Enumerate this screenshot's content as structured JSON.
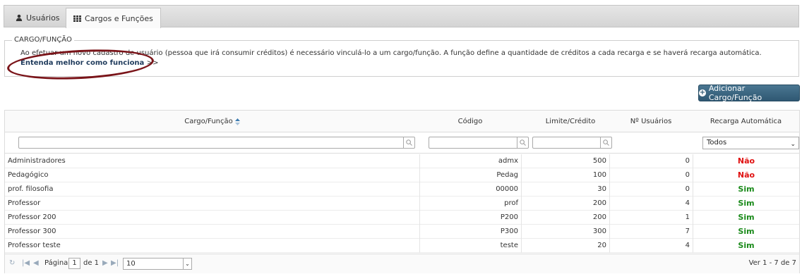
{
  "tabs": [
    {
      "label": "Usuários",
      "icon": "user-icon"
    },
    {
      "label": "Cargos e Funções",
      "icon": "grid-icon"
    }
  ],
  "section": {
    "legend": "CARGO/FUNÇÃO",
    "text": "Ao efetuar um novo cadastro de usuário (pessoa que irá consumir créditos) é necessário vinculá-lo a um cargo/função. A função define a quantidade de créditos a cada recarga e se haverá recarga automática.",
    "link": "Entenda melhor como funciona",
    "link_suffix": ">>"
  },
  "add_button": "Adicionar Cargo/Função",
  "grid": {
    "columns": {
      "name": "Cargo/Função",
      "code": "Código",
      "limit": "Limite/Crédito",
      "users": "Nº Usuários",
      "recharge": "Recarga Automática"
    },
    "filter_select": "Todos",
    "rows": [
      {
        "name": "Administradores",
        "code": "admx",
        "limit": "500",
        "users": "0",
        "recharge": "Não"
      },
      {
        "name": "Pedagógico",
        "code": "Pedag",
        "limit": "100",
        "users": "0",
        "recharge": "Não"
      },
      {
        "name": "prof. filosofia",
        "code": "00000",
        "limit": "30",
        "users": "0",
        "recharge": "Sim"
      },
      {
        "name": "Professor",
        "code": "prof",
        "limit": "200",
        "users": "4",
        "recharge": "Sim"
      },
      {
        "name": "Professor 200",
        "code": "P200",
        "limit": "200",
        "users": "1",
        "recharge": "Sim"
      },
      {
        "name": "Professor 300",
        "code": "P300",
        "limit": "300",
        "users": "7",
        "recharge": "Sim"
      },
      {
        "name": "Professor teste",
        "code": "teste",
        "limit": "20",
        "users": "4",
        "recharge": "Sim"
      }
    ]
  },
  "pager": {
    "page_label": "Página",
    "page": "1",
    "of_label": "de 1",
    "page_size": "10",
    "summary": "Ver 1 - 7 de 7"
  },
  "colors": {
    "accent": "#2f5873",
    "no": "#e01010",
    "yes": "#1a8a1a",
    "oval": "#7a1419"
  }
}
